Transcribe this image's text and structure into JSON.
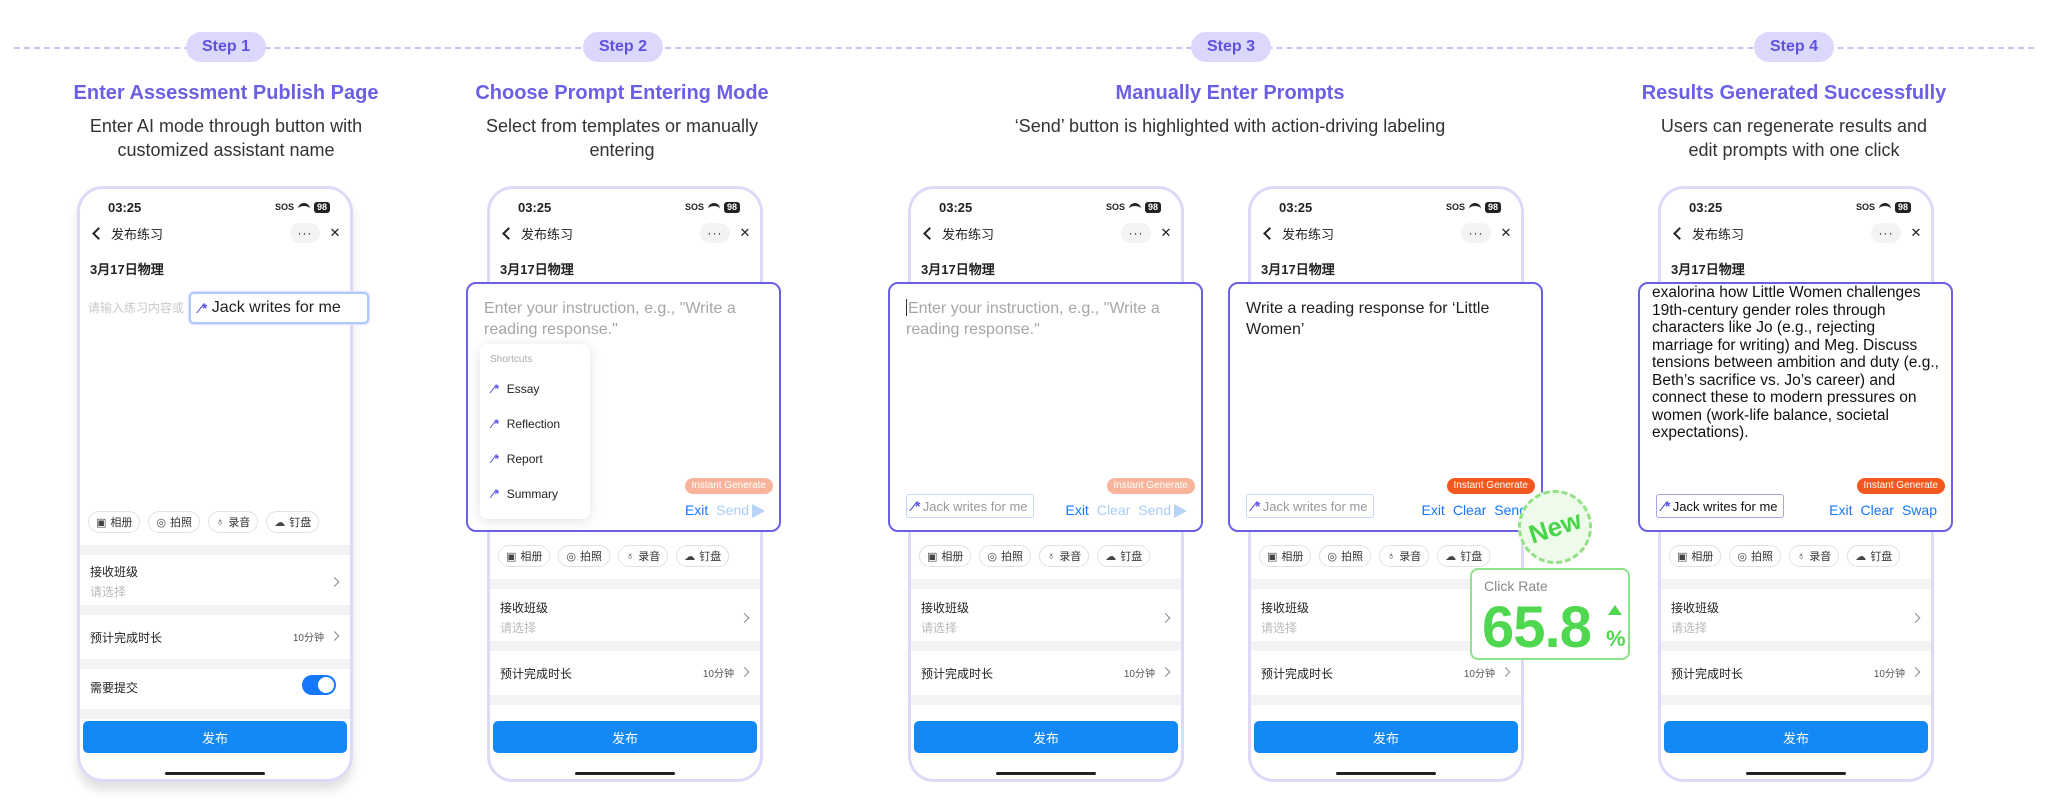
{
  "steps": [
    {
      "label": "Step 1",
      "title": "Enter Assessment Publish Page",
      "desc": "Enter AI mode through button with customized assistant name"
    },
    {
      "label": "Step 2",
      "title": "Choose Prompt Entering Mode",
      "desc": "Select from templates or manually entering"
    },
    {
      "label": "Step 3",
      "title": "Manually Enter Prompts",
      "desc": "‘Send’ button is highlighted with action-driving labeling"
    },
    {
      "label": "Step 4",
      "title": "Results Generated Successfully",
      "desc": "Users can regenerate results and edit prompts with one click"
    }
  ],
  "phone": {
    "time": "03:25",
    "sos": "SOS",
    "battery": "98",
    "nav_title": "发布练习",
    "more": "···",
    "close": "✕",
    "subtitle": "3月17日物理",
    "input_placeholder": "请输入练习内容或",
    "media": [
      "相册",
      "拍照",
      "录音",
      "钉盘"
    ],
    "class_label": "接收班级",
    "class_hint": "请选择",
    "duration_label": "预计完成时长",
    "duration_value": "10分钟",
    "submit_label": "需要提交",
    "publish_label": "发布"
  },
  "ai": {
    "assistant_name": "Jack writes for me",
    "instruction_placeholder": "Enter your instruction, e.g., \"Write a reading response.\"",
    "shortcuts_header": "Shortcuts",
    "shortcuts": [
      "Essay",
      "Reflection",
      "Report",
      "Summary"
    ],
    "exit": "Exit",
    "clear": "Clear",
    "send": "Send",
    "swap": "Swap",
    "instant_generate": "Instant Generate",
    "typed_prompt": "Write a reading response for ‘Little Women’",
    "result_text": "exalorina how Little Women challenges 19th-century gender roles through characters like Jo (e.g., rejecting marriage for writing) and Meg. Discuss tensions between ambition and duty (e.g., Beth’s sacrifice vs. Jo’s career) and connect these to modern pressures on women (work-life balance, societal expectations)."
  },
  "badge": {
    "new": "New",
    "click_rate_label": "Click Rate",
    "click_rate_value": "65.8",
    "click_rate_unit": "%"
  },
  "colors": {
    "accent": "#6b5fe6",
    "blue": "#1677ff",
    "orange": "#f4581f",
    "green": "#4fd84f"
  }
}
